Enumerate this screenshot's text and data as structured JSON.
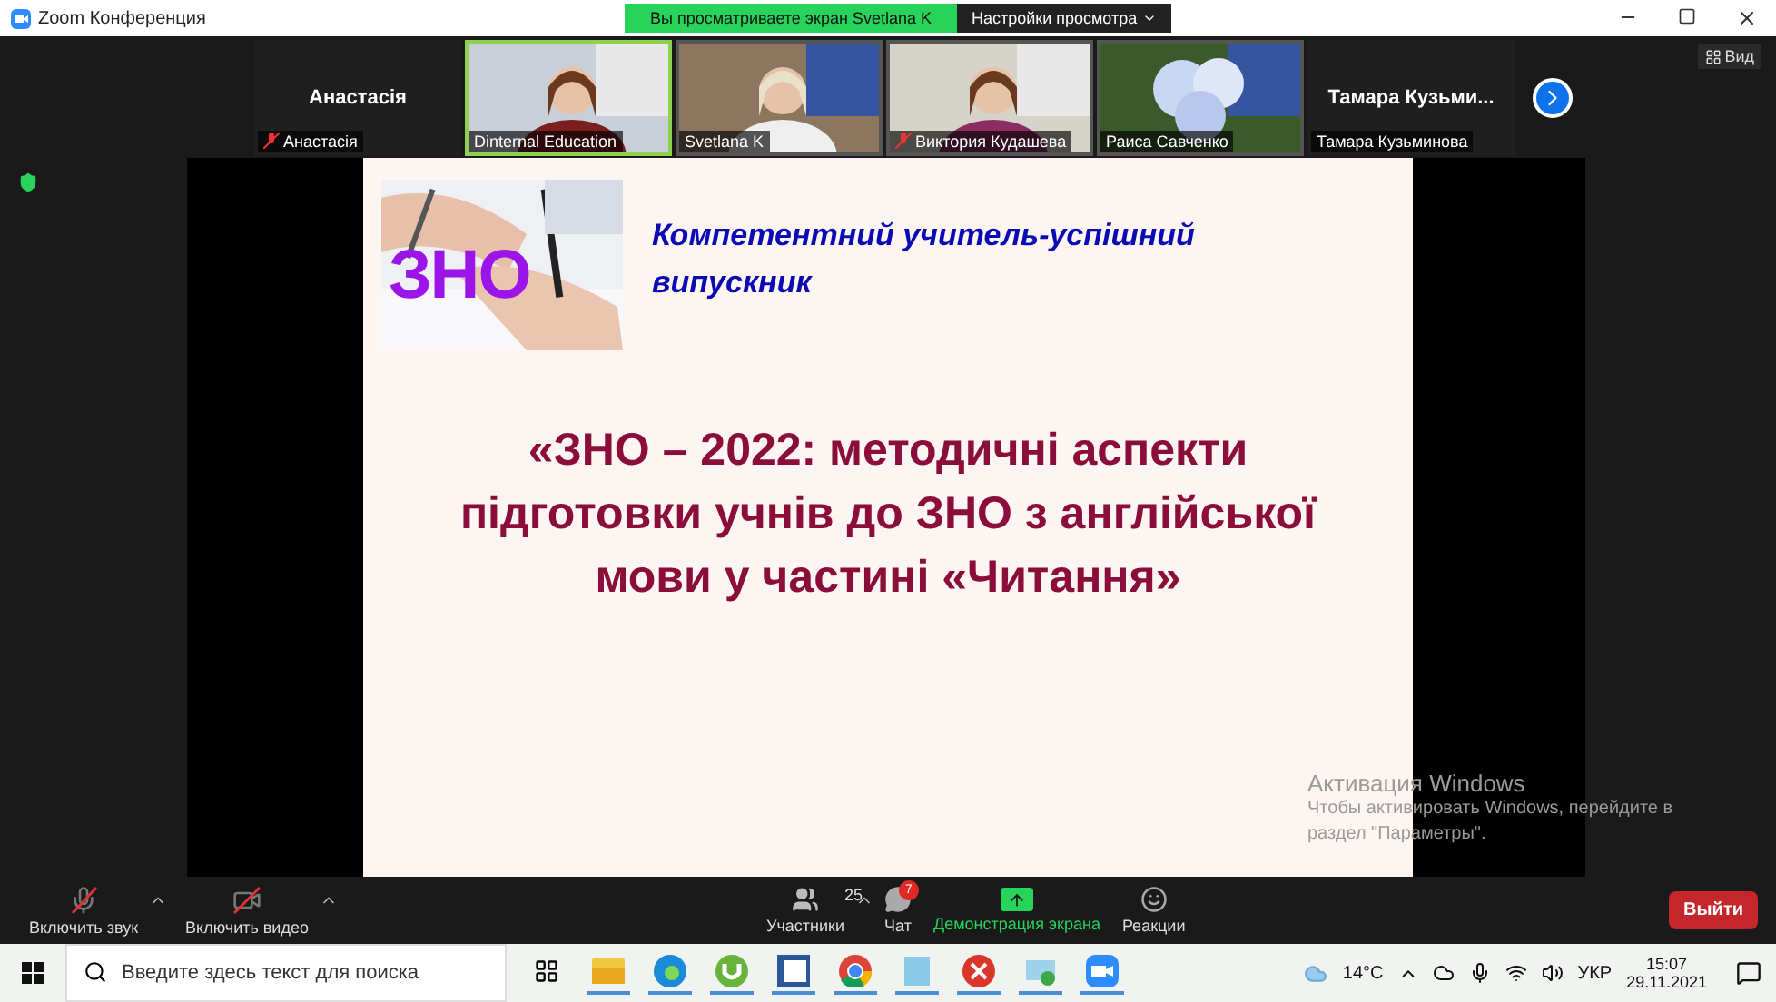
{
  "window": {
    "title": "Zoom Конференция"
  },
  "share_banner": {
    "text": "Вы просматриваете экран Svetlana K",
    "options": "Настройки просмотра"
  },
  "participants": [
    {
      "kind": "name",
      "display": "Анастасія",
      "label": "Анастасія",
      "muted": true,
      "active": false
    },
    {
      "kind": "video",
      "label": "Dinternal Education",
      "muted": false,
      "active": true
    },
    {
      "kind": "video",
      "label": "Svetlana K",
      "muted": false,
      "active": false
    },
    {
      "kind": "video",
      "label": "Виктория Кудашева",
      "muted": true,
      "active": false
    },
    {
      "kind": "video",
      "label": "Раиса Савченко",
      "muted": false,
      "active": false
    },
    {
      "kind": "name",
      "display": "Тамара  Кузьми...",
      "label": "Тамара Кузьминова",
      "muted": false,
      "active": false
    }
  ],
  "view_button": "Вид",
  "slide": {
    "image_caption": "ЗНО",
    "subtitle": "Компетентний учитель-успішний випускник",
    "title": "«ЗНО – 2022: методичні аспекти підготовки учнів до ЗНО з англійської мови у частині «Читання»"
  },
  "activation_notice": {
    "title": "Активация Windows",
    "text": "Чтобы активировать Windows, перейдите в раздел \"Параметры\"."
  },
  "toolbar": [
    {
      "kind": "mic",
      "label": "Включить звук",
      "caret": true
    },
    {
      "kind": "video",
      "label": "Включить видео",
      "caret": true
    },
    {
      "kind": "participants",
      "label": "Участники",
      "count": "25",
      "caret": true
    },
    {
      "kind": "chat",
      "label": "Чат",
      "badge": "7",
      "caret": false
    },
    {
      "kind": "share",
      "label": "Демонстрация экрана",
      "caret": false
    },
    {
      "kind": "reactions",
      "label": "Реакции",
      "caret": false
    }
  ],
  "leave_button": "Выйти",
  "taskbar": {
    "search_placeholder": "Введите здесь текст для поиска",
    "temperature": "14°C",
    "language": "УКР",
    "time": "15:07",
    "date": "29.11.2021"
  }
}
